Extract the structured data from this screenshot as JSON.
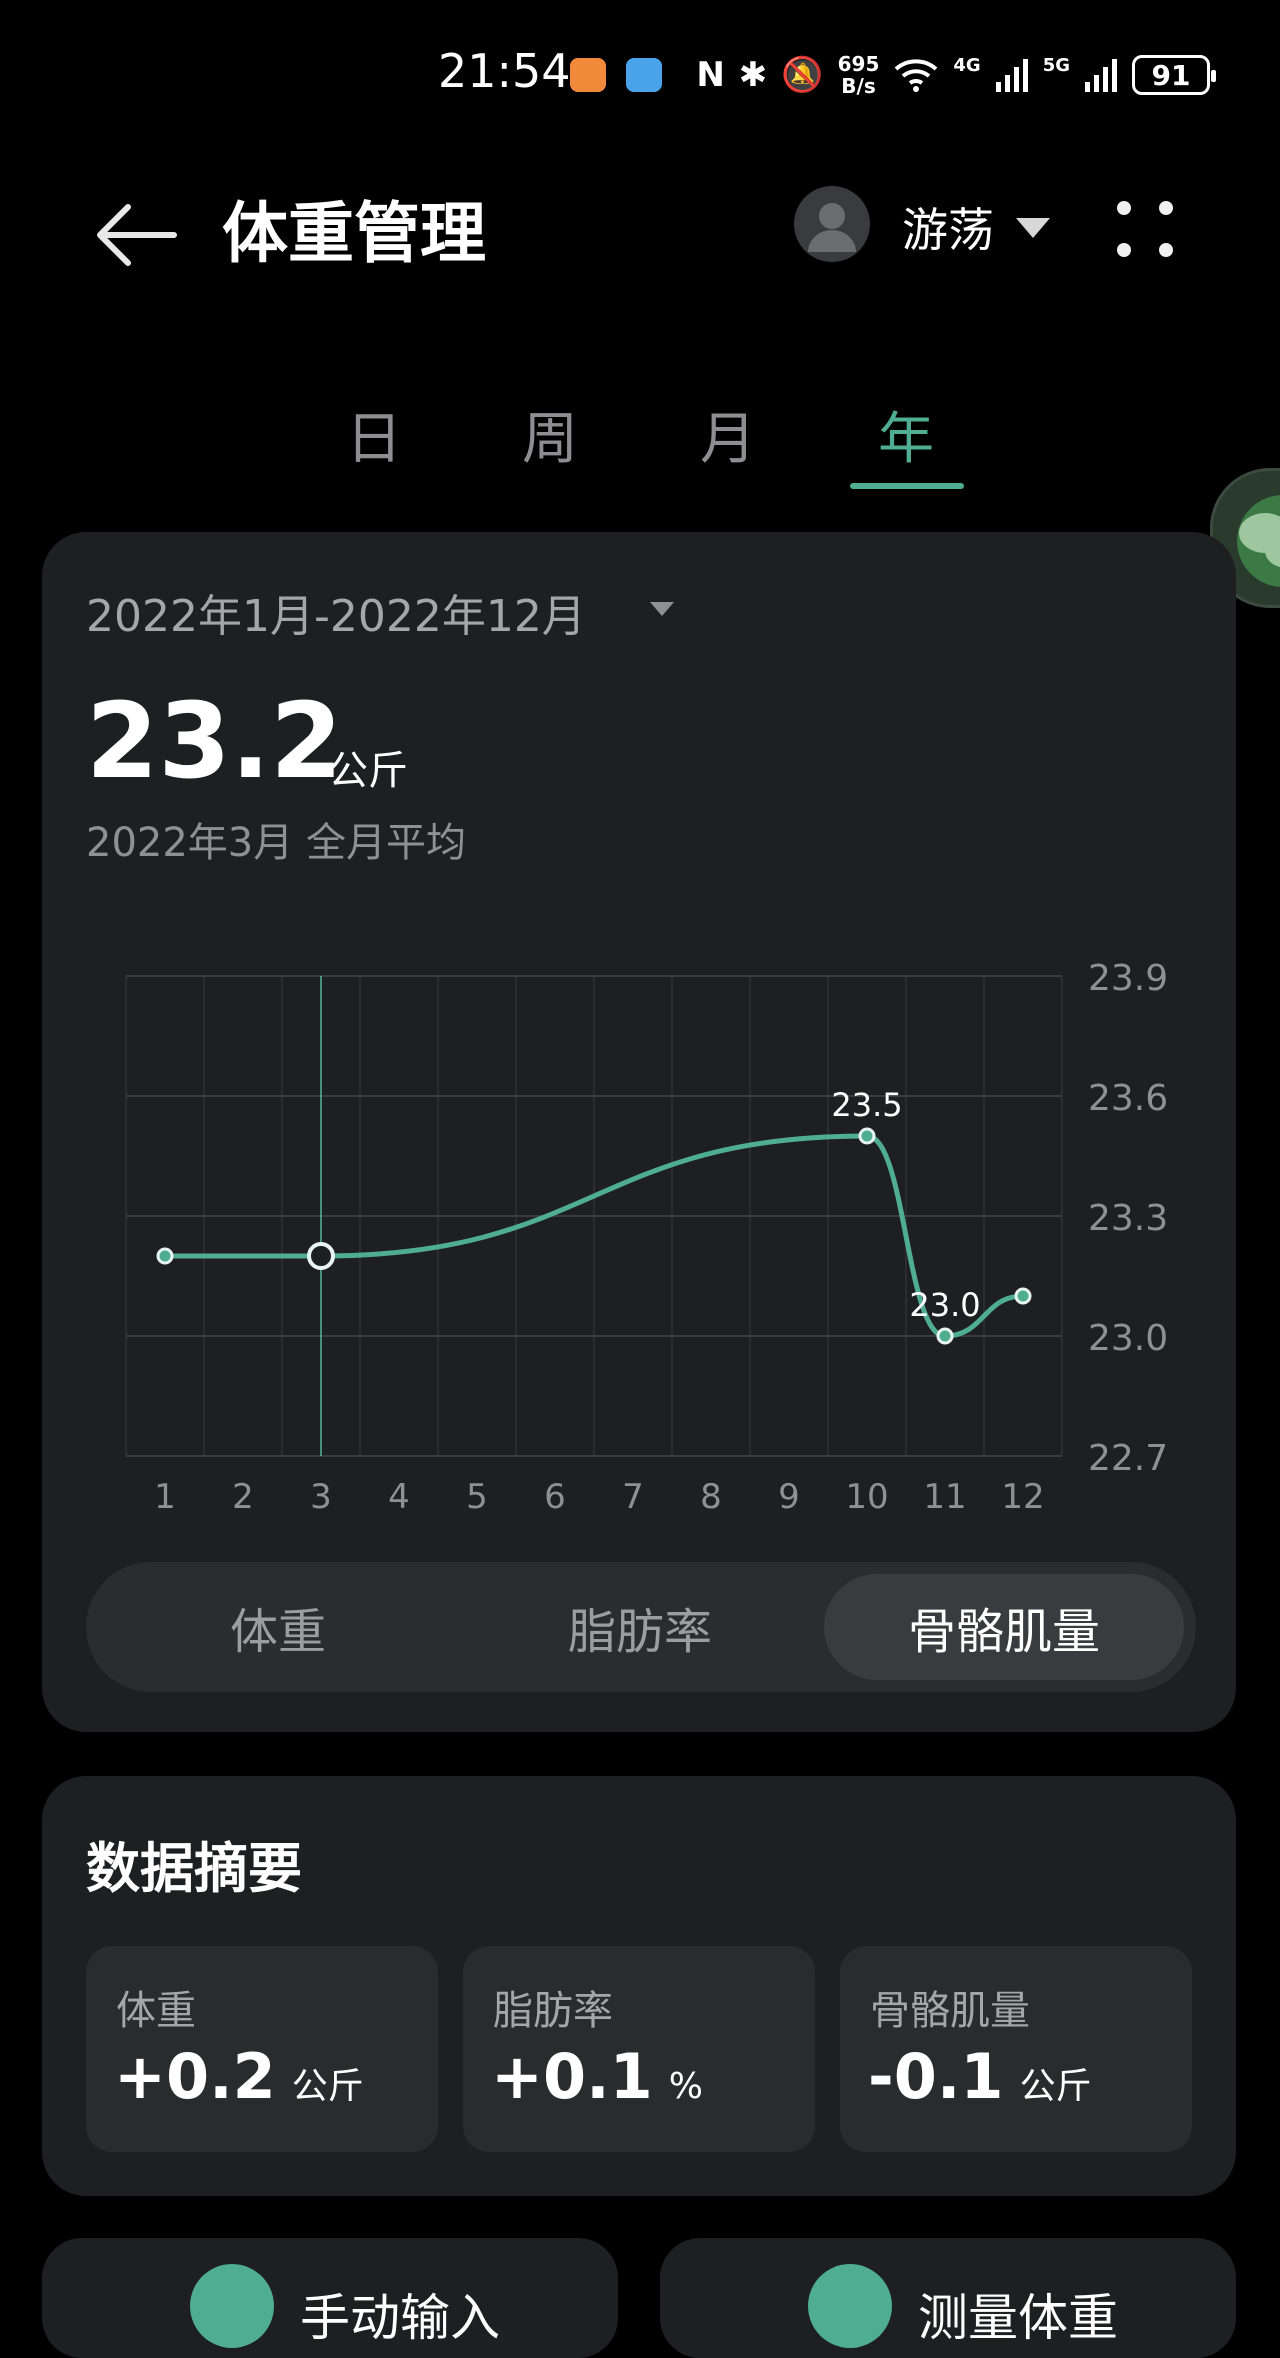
{
  "status_bar": {
    "time": "21:54",
    "speed_value": "695",
    "speed_unit": "B/s",
    "net1": "4G",
    "net2": "5G",
    "battery": "91"
  },
  "header": {
    "title": "体重管理",
    "user_name": "游荡"
  },
  "tabs": [
    {
      "label": "日"
    },
    {
      "label": "周"
    },
    {
      "label": "月"
    },
    {
      "label": "年"
    }
  ],
  "chart_card": {
    "date_range": "2022年1月-2022年12月",
    "value": "23.2",
    "unit": "公斤",
    "caption": "2022年3月 全月平均"
  },
  "chart_data": {
    "type": "line",
    "x": [
      1,
      3,
      10,
      11,
      12
    ],
    "y": [
      23.2,
      23.2,
      23.5,
      23.0,
      23.1
    ],
    "x_ticks": [
      "1",
      "2",
      "3",
      "4",
      "5",
      "6",
      "7",
      "8",
      "9",
      "10",
      "11",
      "12"
    ],
    "y_ticks": [
      "23.9",
      "23.6",
      "23.3",
      "23.0",
      "22.7"
    ],
    "ylim": [
      22.7,
      23.9
    ],
    "xlim": [
      0.5,
      12.5
    ],
    "selected_x": 3,
    "data_labels": [
      {
        "x": 10,
        "y": 23.5,
        "text": "23.5"
      },
      {
        "x": 11,
        "y": 23.0,
        "text": "23.0"
      }
    ],
    "line_color": "#4fae92",
    "grid": true
  },
  "metric_toggle": [
    {
      "label": "体重",
      "active": false
    },
    {
      "label": "脂肪率",
      "active": false
    },
    {
      "label": "骨骼肌量",
      "active": true
    }
  ],
  "summary": {
    "title": "数据摘要",
    "items": [
      {
        "label": "体重",
        "value": "+0.2",
        "unit": "公斤"
      },
      {
        "label": "脂肪率",
        "value": "+0.1",
        "unit": "%"
      },
      {
        "label": "骨骼肌量",
        "value": "-0.1",
        "unit": "公斤"
      }
    ]
  },
  "bottom_actions": [
    {
      "label": "手动输入"
    },
    {
      "label": "测量体重"
    }
  ],
  "colors": {
    "accent": "#4fae92",
    "card": "#1e1f21",
    "background": "#000000"
  }
}
